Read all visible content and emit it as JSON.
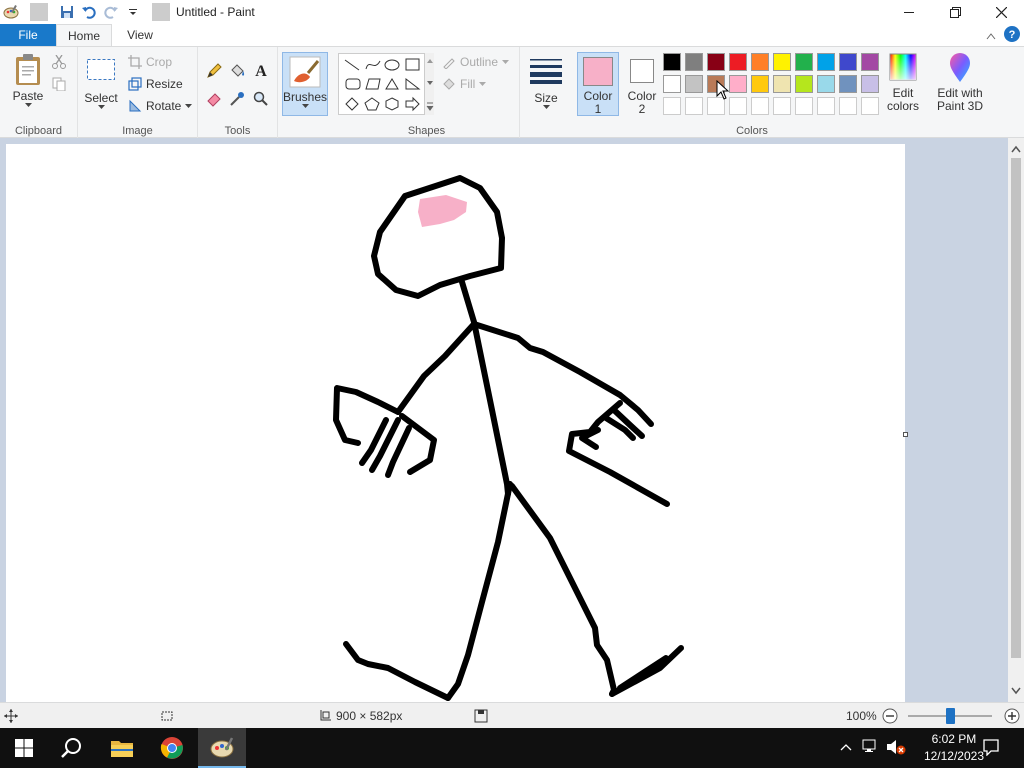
{
  "window": {
    "title": "Untitled - Paint"
  },
  "tabs": [
    {
      "label": "File"
    },
    {
      "label": "Home"
    },
    {
      "label": "View"
    }
  ],
  "ribbon": {
    "clipboard": {
      "paste": "Paste",
      "label": "Clipboard"
    },
    "image": {
      "select": "Select",
      "crop": "Crop",
      "resize": "Resize",
      "rotate": "Rotate",
      "label": "Image"
    },
    "tools": {
      "label": "Tools"
    },
    "brushes": {
      "label": "Brushes"
    },
    "shapes": {
      "outline": "Outline",
      "fill": "Fill",
      "label": "Shapes"
    },
    "size": {
      "label": "Size"
    },
    "colors": {
      "color1_label": "Color",
      "color1_num": "1",
      "color2_label": "Color",
      "color2_num": "2",
      "edit_colors_1": "Edit",
      "edit_colors_2": "colors",
      "edit_3d_1": "Edit with",
      "edit_3d_2": "Paint 3D",
      "label": "Colors",
      "color1": "#f7b0c8",
      "color2": "#ffffff",
      "palette_row1": [
        "#000000",
        "#7f7f7f",
        "#880015",
        "#ed1c24",
        "#ff7f27",
        "#fff200",
        "#22b14c",
        "#00a2e8",
        "#3f48cc",
        "#a349a4"
      ],
      "palette_row2": [
        "#ffffff",
        "#c3c3c3",
        "#b97a57",
        "#ffaec9",
        "#ffc90e",
        "#efe4b0",
        "#b5e61d",
        "#99d9ea",
        "#7092be",
        "#c8bfe7"
      ]
    }
  },
  "status": {
    "dimensions": "900 × 582px",
    "zoom": "100%",
    "zoom_level_percent": 100
  },
  "taskbar": {
    "time": "6:02 PM",
    "date": "12/12/2023"
  }
}
